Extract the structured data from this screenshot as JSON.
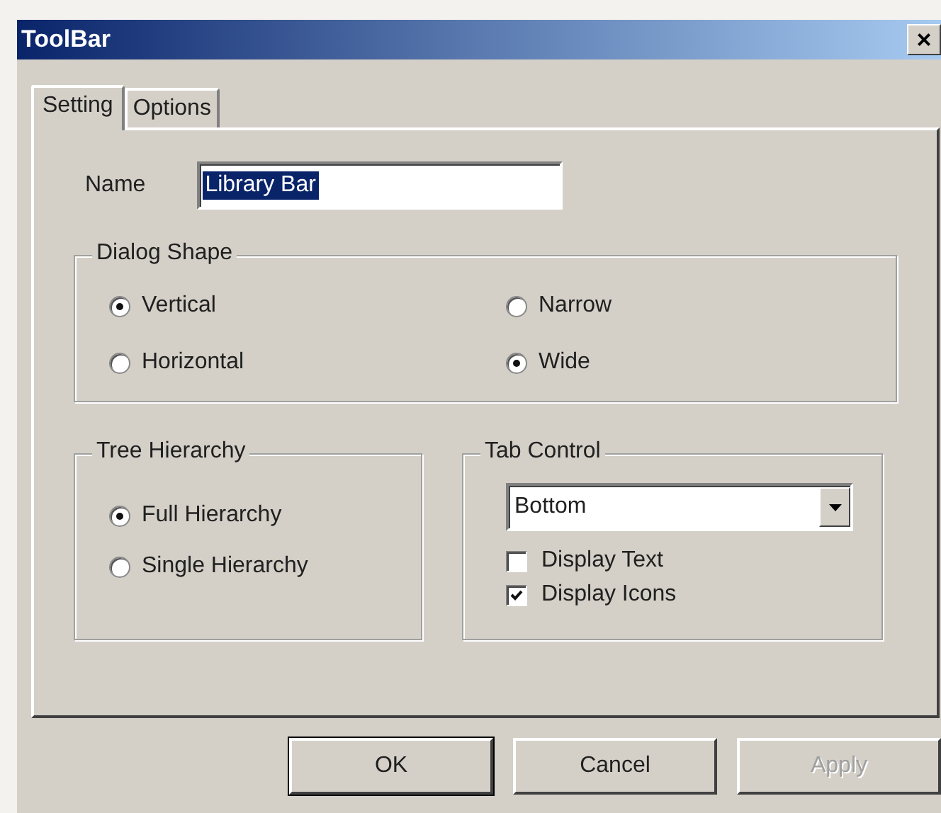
{
  "window": {
    "title": "ToolBar",
    "close": "×"
  },
  "tabs": [
    {
      "label": "Setting",
      "selected": true
    },
    {
      "label": "Options",
      "selected": false
    }
  ],
  "name_field": {
    "label": "Name",
    "value": "Library Bar",
    "text_selected": true
  },
  "dialog_shape": {
    "title": "Dialog Shape",
    "options": [
      {
        "label": "Vertical",
        "selected": true
      },
      {
        "label": "Narrow",
        "selected": false
      },
      {
        "label": "Horizontal",
        "selected": false
      },
      {
        "label": "Wide",
        "selected": true
      }
    ]
  },
  "tree_hierarchy": {
    "title": "Tree Hierarchy",
    "options": [
      {
        "label": "Full Hierarchy",
        "selected": true
      },
      {
        "label": "Single Hierarchy",
        "selected": false
      }
    ]
  },
  "tab_control": {
    "title": "Tab Control",
    "dropdown": "Bottom",
    "checkboxes": [
      {
        "label": "Display Text",
        "checked": false
      },
      {
        "label": "Display Icons",
        "checked": true
      }
    ]
  },
  "buttons": [
    {
      "label": "OK",
      "default": true,
      "disabled": false
    },
    {
      "label": "Cancel",
      "default": false,
      "disabled": false
    },
    {
      "label": "Apply",
      "default": false,
      "disabled": true
    }
  ]
}
